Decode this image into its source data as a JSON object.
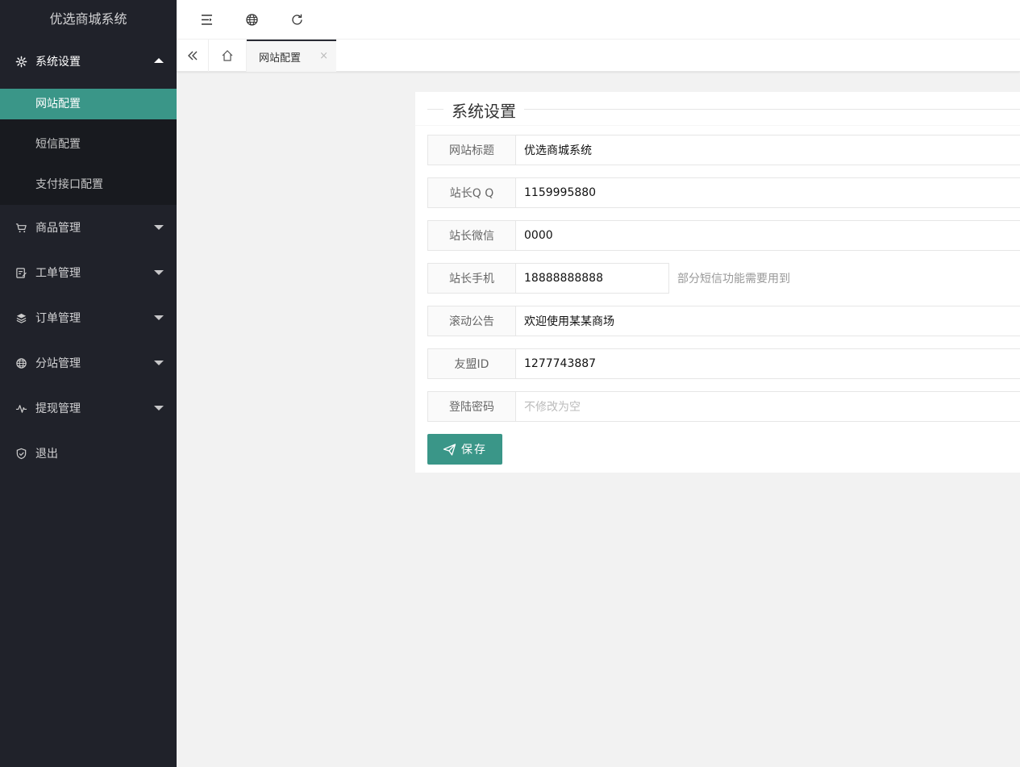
{
  "app": {
    "title": "优选商城系统"
  },
  "sidebar": {
    "groups": [
      {
        "label": "系统设置",
        "icon": "gear-icon",
        "expanded": true,
        "children": [
          "网站配置",
          "短信配置",
          "支付接口配置"
        ],
        "active_child": "网站配置"
      },
      {
        "label": "商品管理",
        "icon": "cart-icon",
        "expanded": false
      },
      {
        "label": "工单管理",
        "icon": "ticket-icon",
        "expanded": false
      },
      {
        "label": "订单管理",
        "icon": "layers-icon",
        "expanded": false
      },
      {
        "label": "分站管理",
        "icon": "globe-icon",
        "expanded": false
      },
      {
        "label": "提现管理",
        "icon": "pulse-icon",
        "expanded": false
      },
      {
        "label": "退出",
        "icon": "shield-icon"
      }
    ]
  },
  "header": {
    "icons": [
      "menu-fold-icon",
      "globe-icon",
      "refresh-icon"
    ]
  },
  "tabs": {
    "active": "网站配置",
    "close": "×"
  },
  "form": {
    "legend": "系统设置",
    "fields": [
      {
        "label": "网站标题",
        "value": "优选商城系统"
      },
      {
        "label": "站长Q Q",
        "value": "1159995880"
      },
      {
        "label": "站长微信",
        "value": "0000"
      },
      {
        "label": "站长手机",
        "value": "18888888888",
        "hint": "部分短信功能需要用到"
      },
      {
        "label": "滚动公告",
        "value": "欢迎使用某某商场"
      },
      {
        "label": "友盟ID",
        "value": "1277743887"
      },
      {
        "label": "登陆密码",
        "placeholder": "不修改为空",
        "value": ""
      }
    ],
    "save_label": "保存"
  },
  "colors": {
    "sidebar_bg": "#20222a",
    "accent": "#3a9688",
    "subnav_bg": "#181a1f"
  }
}
